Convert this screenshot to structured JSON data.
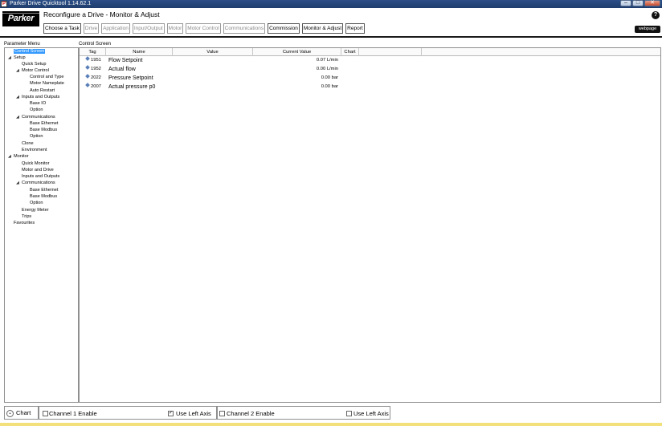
{
  "window": {
    "title": "Parker Drive Quicktool 1.14.62.1",
    "controls": [
      "–",
      "□",
      "✕"
    ]
  },
  "header": {
    "logo_text": "Parker",
    "title": "Reconfigure a Drive - Monitor & Adjust",
    "help": "?",
    "webpage_label": "webpage"
  },
  "tabs": [
    {
      "label": "Choose a Task",
      "enabled": true
    },
    {
      "label": "Drive",
      "enabled": false
    },
    {
      "label": "Application",
      "enabled": false
    },
    {
      "label": "Input/Output",
      "enabled": false
    },
    {
      "label": "Motor",
      "enabled": false
    },
    {
      "label": "Motor Control",
      "enabled": false
    },
    {
      "label": "Communications",
      "enabled": false
    },
    {
      "label": "Commission",
      "enabled": true
    },
    {
      "label": "Monitor & Adjust",
      "enabled": true
    },
    {
      "label": "Report",
      "enabled": true
    }
  ],
  "left_panel": {
    "label": "Parameter Menu",
    "tree": [
      {
        "label": "Control Screen",
        "level": 1,
        "selected": true
      },
      {
        "label": "Setup",
        "level": 1,
        "expanded": true
      },
      {
        "label": "Quick Setup",
        "level": 2
      },
      {
        "label": "Motor Control",
        "level": 2,
        "expanded": true
      },
      {
        "label": "Control and Type",
        "level": 3
      },
      {
        "label": "Motor Nameplate",
        "level": 3
      },
      {
        "label": "Auto Restart",
        "level": 3
      },
      {
        "label": "Inputs and Outputs",
        "level": 2,
        "expanded": true
      },
      {
        "label": "Base IO",
        "level": 3
      },
      {
        "label": "Option",
        "level": 3
      },
      {
        "label": "Communications",
        "level": 2,
        "expanded": true
      },
      {
        "label": "Base Ethernet",
        "level": 3
      },
      {
        "label": "Base Modbus",
        "level": 3
      },
      {
        "label": "Option",
        "level": 3
      },
      {
        "label": "Clone",
        "level": 2
      },
      {
        "label": "Environment",
        "level": 2
      },
      {
        "label": "Monitor",
        "level": 1,
        "expanded": true
      },
      {
        "label": "Quick Monitor",
        "level": 2
      },
      {
        "label": "Motor and Drive",
        "level": 2
      },
      {
        "label": "Inputs and Outputs",
        "level": 2
      },
      {
        "label": "Communications",
        "level": 2,
        "expanded": true
      },
      {
        "label": "Base Ethernet",
        "level": 3
      },
      {
        "label": "Base Modbus",
        "level": 3
      },
      {
        "label": "Option",
        "level": 3
      },
      {
        "label": "Energy Meter",
        "level": 2
      },
      {
        "label": "Trips",
        "level": 2
      },
      {
        "label": "Favourites",
        "level": 1
      }
    ]
  },
  "control_screen": {
    "label": "Control Screen",
    "columns": [
      "Tag",
      "Name",
      "Value",
      "Current Value",
      "Chart"
    ],
    "rows": [
      {
        "tag": "1951",
        "name": "Flow Setpoint",
        "value": "",
        "current": "0.07 L/min"
      },
      {
        "tag": "1952",
        "name": "Actual flow",
        "value": "",
        "current": "0.00 L/min"
      },
      {
        "tag": "2022",
        "name": "Pressure Setpoint",
        "value": "",
        "current": "0.00 bar"
      },
      {
        "tag": "2007",
        "name": "Actual pressure p0",
        "value": "",
        "current": "0.00 bar"
      }
    ]
  },
  "bottom_bar": {
    "chart_label": "Chart",
    "toggle_glyph": "⌄",
    "channel1_label": "Channel 1 Enable",
    "channel1_checked": false,
    "left_axis1_label": "Use Left Axis",
    "left_axis1_checked": true,
    "channel2_label": "Channel 2 Enable",
    "channel2_checked": false,
    "left_axis2_label": "Use Left Axis",
    "left_axis2_checked": false
  }
}
